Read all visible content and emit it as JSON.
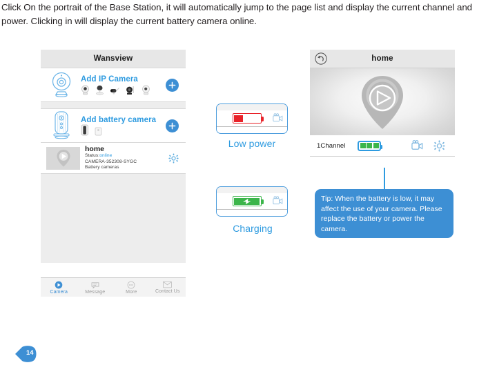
{
  "intro": {
    "paragraph": "Click On the portrait of the Base Station, it will automatically jump to the page list and display the current channel and power. Clicking in will display the current battery camera online."
  },
  "left_phone": {
    "header_title": "Wansview",
    "add_ip_camera": {
      "label": "Add IP Camera",
      "thumb_icon": "ip-camera-icon",
      "plus_icon": "plus-icon",
      "camera_thumbs": [
        "pan-tilt-camera-icon",
        "dome-camera-icon",
        "bullet-camera-icon",
        "ptz-camera-icon",
        "indoor-camera-icon"
      ]
    },
    "add_battery_camera": {
      "label": "Add battery camera",
      "thumb_icon": "base-station-icon",
      "plus_icon": "plus-icon",
      "camera_thumbs": [
        "battery-camera-icon",
        "battery-sensor-icon"
      ]
    },
    "device": {
      "name": "home",
      "status_label": "Status:",
      "status_value": "online",
      "device_id": "CAMERA-352308-SYGC",
      "device_type": "Battery cameras",
      "gear_icon": "gear-icon",
      "play_icon": "play-icon"
    },
    "tabbar": [
      {
        "label": "Camera",
        "icon": "camera-icon",
        "active": true
      },
      {
        "label": "Message",
        "icon": "message-icon",
        "active": false
      },
      {
        "label": "More",
        "icon": "more-icon",
        "active": false
      },
      {
        "label": "Contact Us",
        "icon": "mail-icon",
        "active": false
      }
    ]
  },
  "battery_states": [
    {
      "caption": "Low power",
      "icon": "low-battery-icon",
      "color": "#e8232a",
      "fill_percent": 34
    },
    {
      "caption": "Charging",
      "icon": "charging-battery-icon",
      "color": "#3bb54a",
      "fill_percent": 100
    }
  ],
  "right_phone": {
    "header_title": "home",
    "back_icon": "back-arrow-icon",
    "video_play_icon": "play-icon",
    "channel_label": "1Channel",
    "battery_icon": "battery-full-icon",
    "battery_segments": 3,
    "battery_color": "#3bb54a",
    "video_icon": "video-camera-icon",
    "settings_icon": "gear-icon"
  },
  "tooltip": {
    "text": "Tip: When the battery is low, it may affect the use of your camera. Please replace the battery or power the camera."
  },
  "page_badge": {
    "number": "14",
    "color": "#3d8fd4"
  }
}
